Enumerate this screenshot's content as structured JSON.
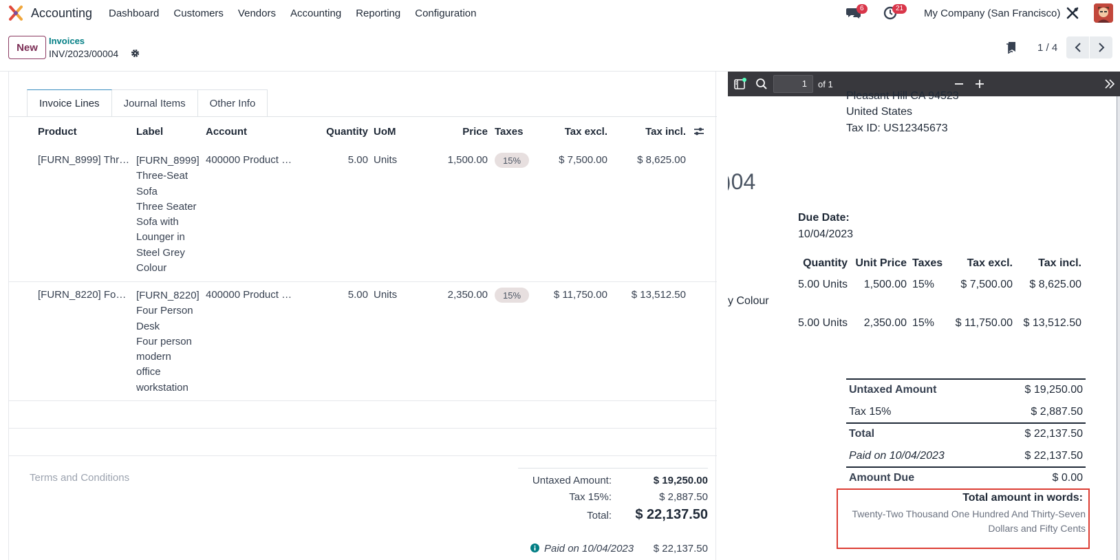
{
  "app": {
    "name": "Accounting",
    "menu": [
      "Dashboard",
      "Customers",
      "Vendors",
      "Accounting",
      "Reporting",
      "Configuration"
    ],
    "chat_badge": "6",
    "activity_badge": "21",
    "company": "My Company (San Francisco)",
    "badge_color": "#d9364a"
  },
  "control": {
    "new_label": "New",
    "breadcrumb_parent": "Invoices",
    "breadcrumb_current": "INV/2023/00004",
    "pager": "1 / 4"
  },
  "tabs": [
    "Invoice Lines",
    "Journal Items",
    "Other Info"
  ],
  "table": {
    "headers": {
      "product": "Product",
      "label": "Label",
      "account": "Account",
      "quantity": "Quantity",
      "uom": "UoM",
      "price": "Price",
      "taxes": "Taxes",
      "tax_excl": "Tax excl.",
      "tax_incl": "Tax incl."
    },
    "rows": [
      {
        "product": "[FURN_8999] Thr…",
        "label_lines": [
          "[FURN_8999]",
          "Three-Seat",
          "Sofa",
          "Three Seater",
          "Sofa with",
          "Lounger in",
          "Steel Grey",
          "Colour"
        ],
        "account": "400000 Product …",
        "quantity": "5.00",
        "uom": "Units",
        "price": "1,500.00",
        "tax": "15%",
        "tax_excl": "$ 7,500.00",
        "tax_incl": "$ 8,625.00"
      },
      {
        "product": "[FURN_8220] Fo…",
        "label_lines": [
          "[FURN_8220]",
          "Four Person",
          "Desk",
          "Four person",
          "modern",
          "office",
          "workstation"
        ],
        "account": "400000 Product …",
        "quantity": "5.00",
        "uom": "Units",
        "price": "2,350.00",
        "tax": "15%",
        "tax_excl": "$ 11,750.00",
        "tax_incl": "$ 13,512.50"
      }
    ]
  },
  "footer": {
    "terms_placeholder": "Terms and Conditions",
    "untaxed_label": "Untaxed Amount:",
    "untaxed_value": "$ 19,250.00",
    "tax_label": "Tax 15%:",
    "tax_value": "$ 2,887.50",
    "total_label": "Total:",
    "total_value": "$ 22,137.50",
    "paid_label": "Paid on 10/04/2023",
    "paid_value": "$ 22,137.50"
  },
  "pdf": {
    "page_input": "1",
    "page_of": "of 1",
    "address_partial": "Pleasant Hill CA 94523",
    "country": "United States",
    "tax_id": "Tax ID: US12345673",
    "number_partial": ")04",
    "due_date_label": "Due Date:",
    "due_date": "10/04/2023",
    "headers": {
      "quantity": "Quantity",
      "unit_price": "Unit Price",
      "taxes": "Taxes",
      "tax_excl": "Tax excl.",
      "tax_incl": "Tax incl."
    },
    "lines": [
      {
        "desc_partial": "",
        "quantity": "5.00 Units",
        "unit_price": "1,500.00",
        "taxes": "15%",
        "tax_excl": "$ 7,500.00",
        "tax_incl": "$ 8,625.00"
      },
      {
        "desc_partial": "y Colour",
        "quantity": "5.00 Units",
        "unit_price": "2,350.00",
        "taxes": "15%",
        "tax_excl": "$ 11,750.00",
        "tax_incl": "$ 13,512.50"
      }
    ],
    "summary": {
      "untaxed_label": "Untaxed Amount",
      "untaxed_value": "$ 19,250.00",
      "tax_label": "Tax 15%",
      "tax_value": "$ 2,887.50",
      "total_label": "Total",
      "total_value": "$ 22,137.50",
      "paid_label": "Paid on 10/04/2023",
      "paid_value": "$ 22,137.50",
      "due_label": "Amount Due",
      "due_value": "$ 0.00"
    },
    "words_title": "Total amount in words:",
    "words_line1": "Twenty-Two Thousand One Hundred And Thirty-Seven",
    "words_line2": "Dollars and Fifty Cents",
    "highlight_color": "#dc3c32"
  }
}
